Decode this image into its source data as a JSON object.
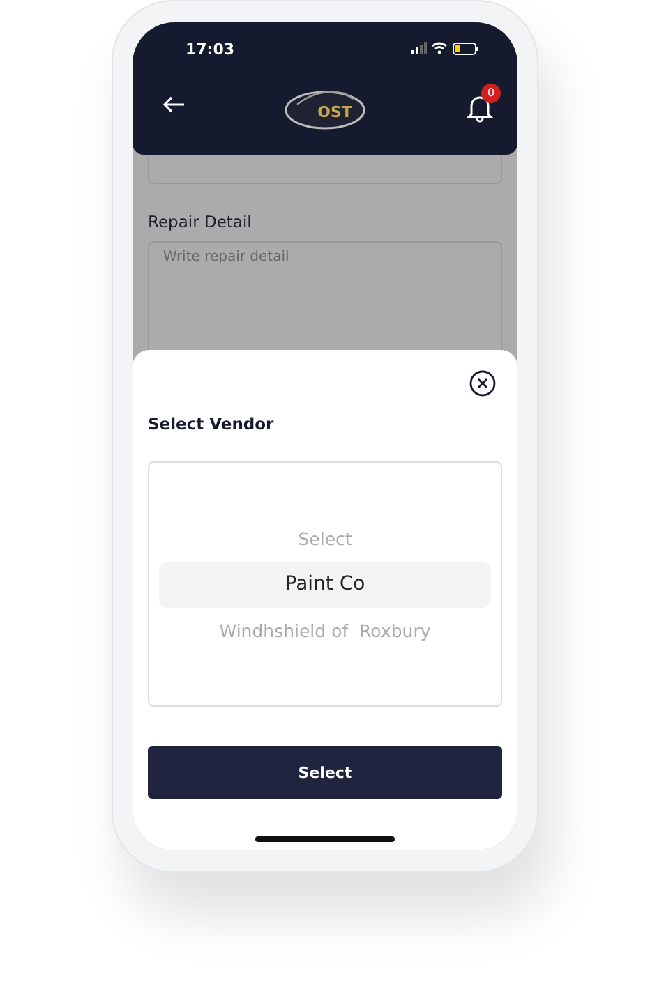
{
  "status_bar": {
    "time": "17:03"
  },
  "header": {
    "logo_text": "OST",
    "notification_count": "0"
  },
  "form": {
    "repair_detail": {
      "label": "Repair Detail",
      "placeholder": "Write repair detail"
    }
  },
  "sheet": {
    "title": "Select Vendor",
    "options": [
      {
        "label": "Select",
        "selected": false
      },
      {
        "label": "Paint Co",
        "selected": true
      },
      {
        "label": "Windhshield of  Roxbury",
        "selected": false
      }
    ],
    "button": "Select"
  }
}
